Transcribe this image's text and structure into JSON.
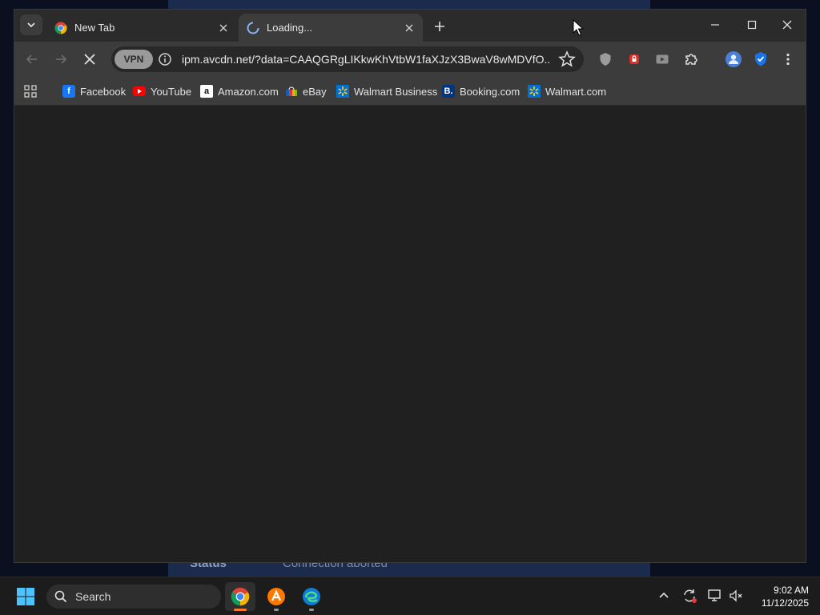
{
  "background_window": {
    "status_label": "Status",
    "status_value": "Connection aborted"
  },
  "browser": {
    "tabs": [
      {
        "title": "New Tab",
        "icon": "chrome-icon",
        "active": false
      },
      {
        "title": "Loading...",
        "icon": "loading-spinner-icon",
        "active": true
      }
    ],
    "toolbar": {
      "vpn_label": "VPN",
      "url": "ipm.avcdn.net/?data=CAAQGRgLIKkwKhVtbW1faXJzX3BwaV8wMDVfO..."
    },
    "bookmarks": [
      {
        "label": "Facebook",
        "icon": "facebook-icon",
        "color": "#1877f2"
      },
      {
        "label": "YouTube",
        "icon": "youtube-icon",
        "color": "#ff0000"
      },
      {
        "label": "Amazon.com",
        "icon": "amazon-icon",
        "color": "#ffffff"
      },
      {
        "label": "eBay",
        "icon": "ebay-icon",
        "color": "#e53238"
      },
      {
        "label": "Walmart Business",
        "icon": "walmart-icon",
        "color": "#0071ce"
      },
      {
        "label": "Booking.com",
        "icon": "booking-icon",
        "color": "#003580"
      },
      {
        "label": "Walmart.com",
        "icon": "walmart-icon",
        "color": "#0071ce"
      }
    ]
  },
  "taskbar": {
    "search_placeholder": "Search",
    "clock_time": "9:02 AM",
    "clock_date": "11/12/2025"
  },
  "colors": {
    "accent_blue": "#3b82f6",
    "content_bg": "#202020",
    "toolbar_bg": "#3c3c3c"
  }
}
